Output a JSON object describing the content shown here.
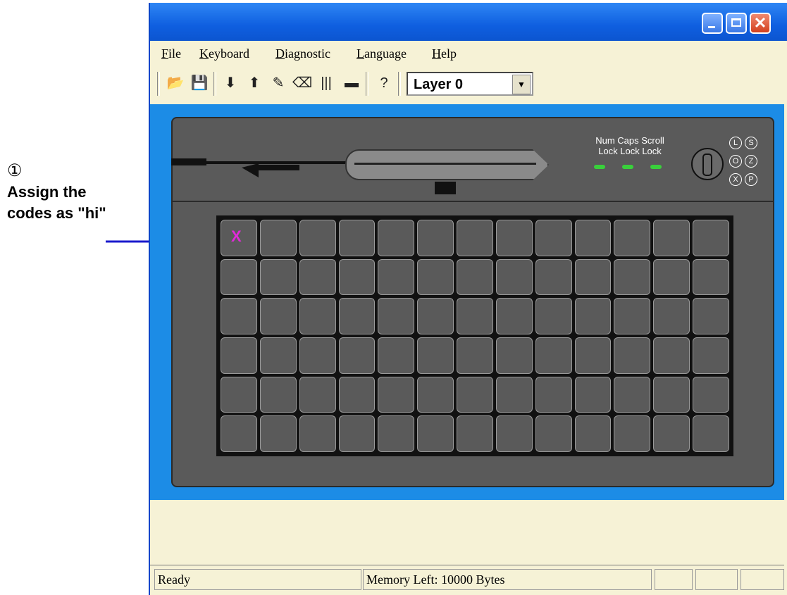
{
  "annotation": {
    "number": "①",
    "line1": "Assign the",
    "line2": "codes as \"hi\""
  },
  "window": {
    "menu": [
      "File",
      "Keyboard",
      "Diagnostic",
      "Language",
      "Help"
    ],
    "toolbar": {
      "icons": [
        "open-icon",
        "save-icon",
        "read-keyboard-icon",
        "write-keyboard-icon",
        "test-icon",
        "eraser-icon",
        "barcode-icon",
        "magnetic-card-icon",
        "help-icon"
      ],
      "layer": "Layer 0"
    },
    "leds": {
      "num": "Num Lock",
      "caps": "Caps Lock",
      "scroll": "Scroll Lock"
    },
    "led_labels": {
      "row1": "Num Caps Scroll",
      "row2": "Lock Lock Lock"
    },
    "keylock_modes": [
      "L",
      "S",
      "O",
      "Z",
      "X",
      "P"
    ],
    "grid": {
      "rows": 6,
      "cols": 13,
      "marked_key_label": "X"
    },
    "status": {
      "ready": "Ready",
      "memory": "Memory Left:  10000 Bytes"
    },
    "colors": {
      "title_bar": "#0f5fe0",
      "canvas_bg": "#1c8ce6",
      "device": "#5a5a5a",
      "led": "#39d03b",
      "marked_key": "#e02ad8",
      "window_bg": "#f6f2d6"
    }
  }
}
